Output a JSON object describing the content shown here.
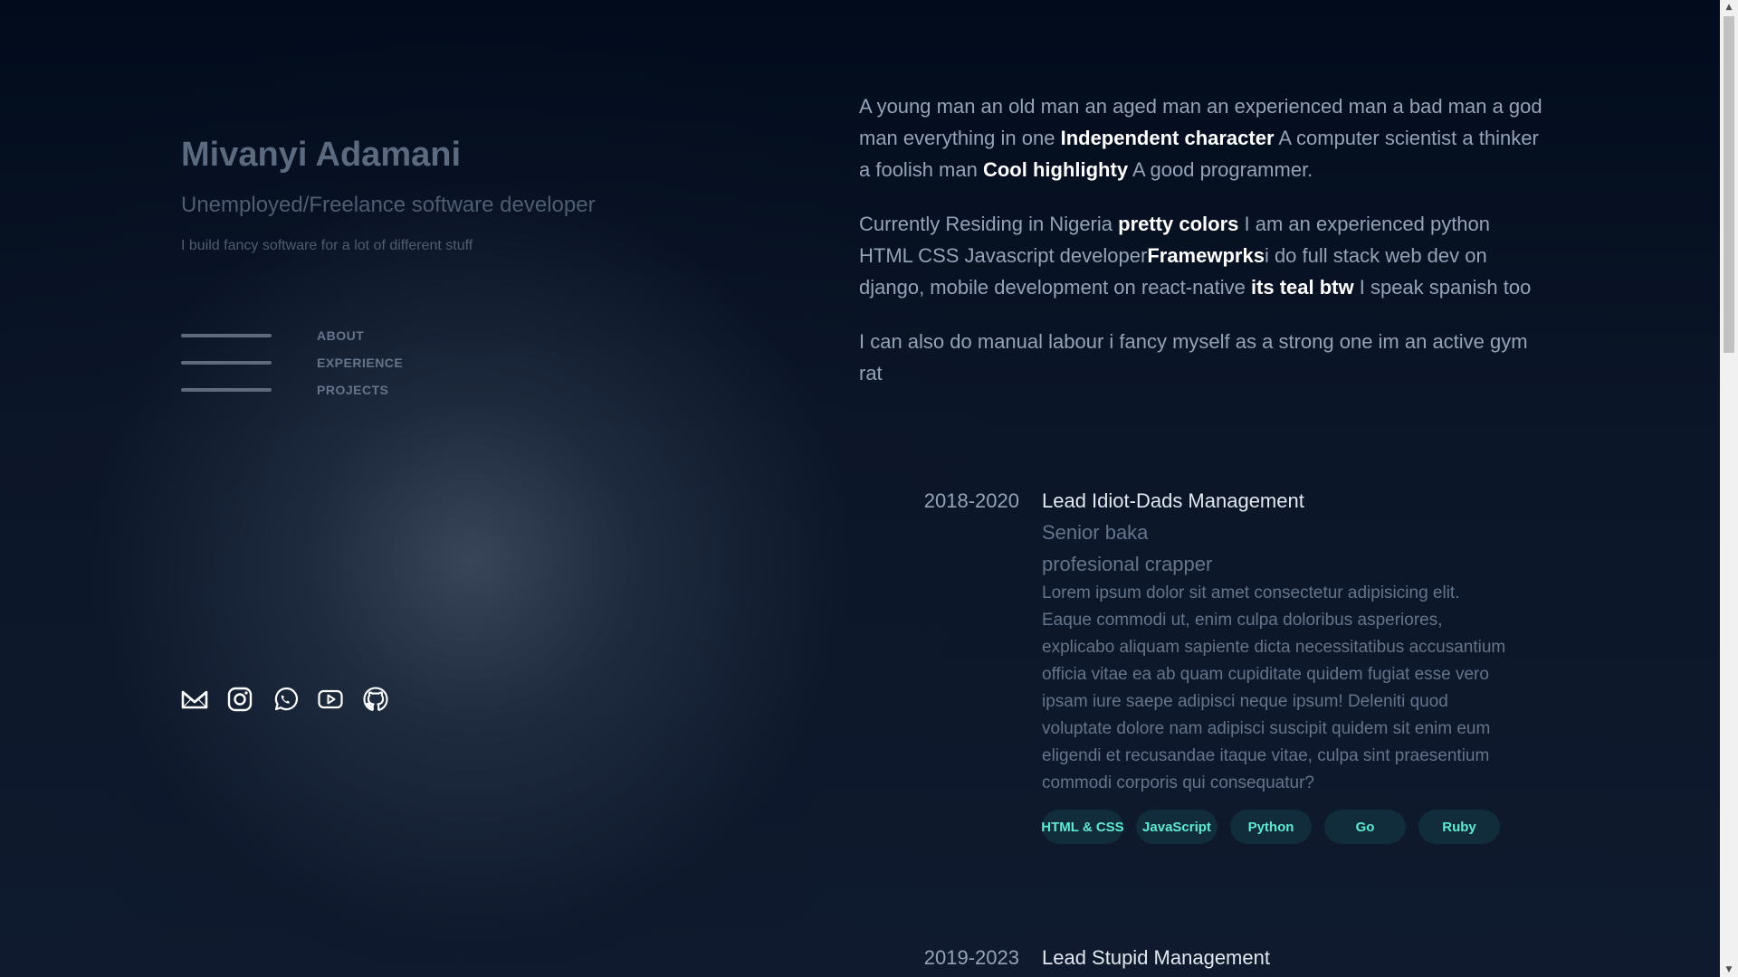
{
  "profile": {
    "name": "Mivanyi Adamani",
    "role": "Unemployed/Freelance software developer",
    "tagline": "I build fancy software for a lot of different stuff"
  },
  "nav": {
    "items": [
      {
        "label": "ABOUT"
      },
      {
        "label": "EXPERIENCE"
      },
      {
        "label": "PROJECTS"
      }
    ]
  },
  "socials": [
    {
      "icon": "gmail-icon"
    },
    {
      "icon": "instagram-icon"
    },
    {
      "icon": "whatsapp-icon"
    },
    {
      "icon": "youtube-icon"
    },
    {
      "icon": "github-icon"
    }
  ],
  "about": {
    "p1": {
      "t1": "A young man an old man an aged man an experienced man a bad man a god man everything in one ",
      "b1": "Independent character",
      "t2": " A computer scientist a thinker a foolish man ",
      "b2": "Cool highlighty",
      "t3": " A good programmer."
    },
    "p2": {
      "t1": "Currently Residing in Nigeria ",
      "b1": "pretty colors",
      "t2": " I am an experienced python HTML CSS Javascript developer",
      "b2": "Framewprks",
      "t3": "i do full stack web dev on django, mobile development on react-native ",
      "b3": "its teal btw",
      "t4": " I speak spanish too"
    },
    "p3": "I can also do manual labour i fancy myself as a strong one im an active gym rat"
  },
  "experience": [
    {
      "date": "2018-2020",
      "title": "Lead Idiot-Dads Management",
      "subtitle1": "Senior baka",
      "subtitle2": "profesional crapper",
      "description": "Lorem ipsum dolor sit amet consectetur adipisicing elit. Eaque commodi ut, enim culpa doloribus asperiores, explicabo aliquam sapiente dicta necessitatibus accusantium officia vitae ea ab quam cupiditate quidem fugiat esse vero ipsam iure saepe adipisci neque ipsum! Deleniti quod voluptate dolore nam adipisci suscipit quidem sit enim eum eligendi et recusandae itaque vitae, culpa sint praesentium commodi corporis qui consequatur?",
      "tags": [
        "HTML & CSS",
        "JavaScript",
        "Python",
        "Go",
        "Ruby"
      ]
    },
    {
      "date": "2019-2023",
      "title": "Lead Stupid Management"
    }
  ],
  "colors": {
    "accent_teal": "#5eead4",
    "heading": "#e2e8f0",
    "body_text": "#94a3b8",
    "muted": "#64748b",
    "background": "#020c1b"
  }
}
